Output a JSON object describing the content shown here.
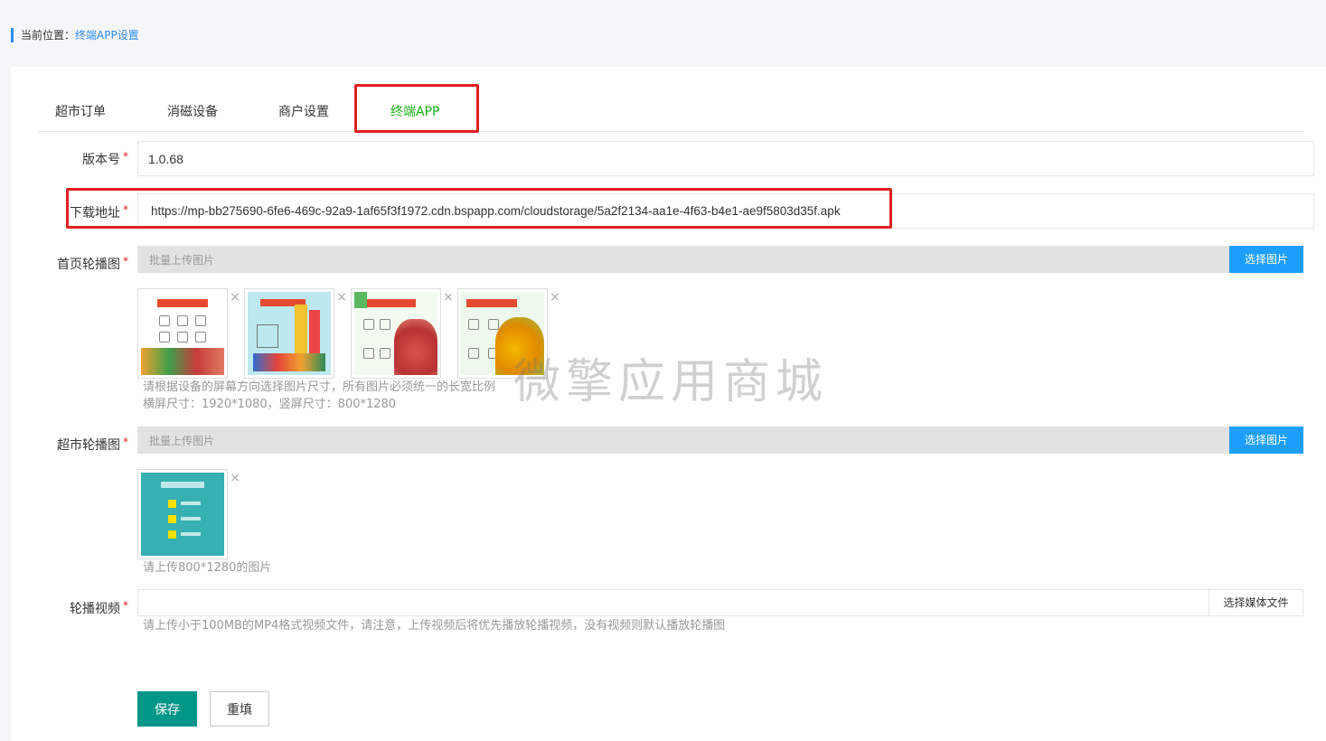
{
  "breadcrumb": {
    "prefix": "当前位置：",
    "current": "终端APP设置"
  },
  "tabs": [
    {
      "label": "超市订单"
    },
    {
      "label": "消磁设备"
    },
    {
      "label": "商户设置"
    },
    {
      "label": "终端APP"
    }
  ],
  "form": {
    "version": {
      "label": "版本号",
      "value": "1.0.68"
    },
    "download": {
      "label": "下载地址",
      "value": "https://mp-bb275690-6fe6-469c-92a9-1af65f3f1972.cdn.bspapp.com/cloudstorage/5a2f2134-aa1e-4f63-b4e1-ae9f5803d35f.apk"
    },
    "home_carousel": {
      "label": "首页轮播图",
      "placeholder": "批量上传图片",
      "button": "选择图片",
      "hint_line1": "请根据设备的屏幕方向选择图片尺寸，所有图片必须统一的长宽比例",
      "hint_line2": "横屏尺寸：1920*1080，竖屏尺寸：800*1280"
    },
    "market_carousel": {
      "label": "超市轮播图",
      "placeholder": "批量上传图片",
      "button": "选择图片",
      "hint": "请上传800*1280的图片"
    },
    "video": {
      "label": "轮播视频",
      "button": "选择媒体文件",
      "hint": "请上传小于100MB的MP4格式视频文件，请注意，上传视频后将优先播放轮播视频，没有视频则默认播放轮播图"
    },
    "required_mark": "*",
    "delete_glyph": "×"
  },
  "buttons": {
    "save": "保存",
    "reset": "重填"
  },
  "watermark": "微擎应用商城",
  "colors": {
    "accent_blue": "#1e9fff",
    "active_tab": "#1aad19",
    "save_green": "#009688",
    "highlight_red": "#e02020"
  }
}
